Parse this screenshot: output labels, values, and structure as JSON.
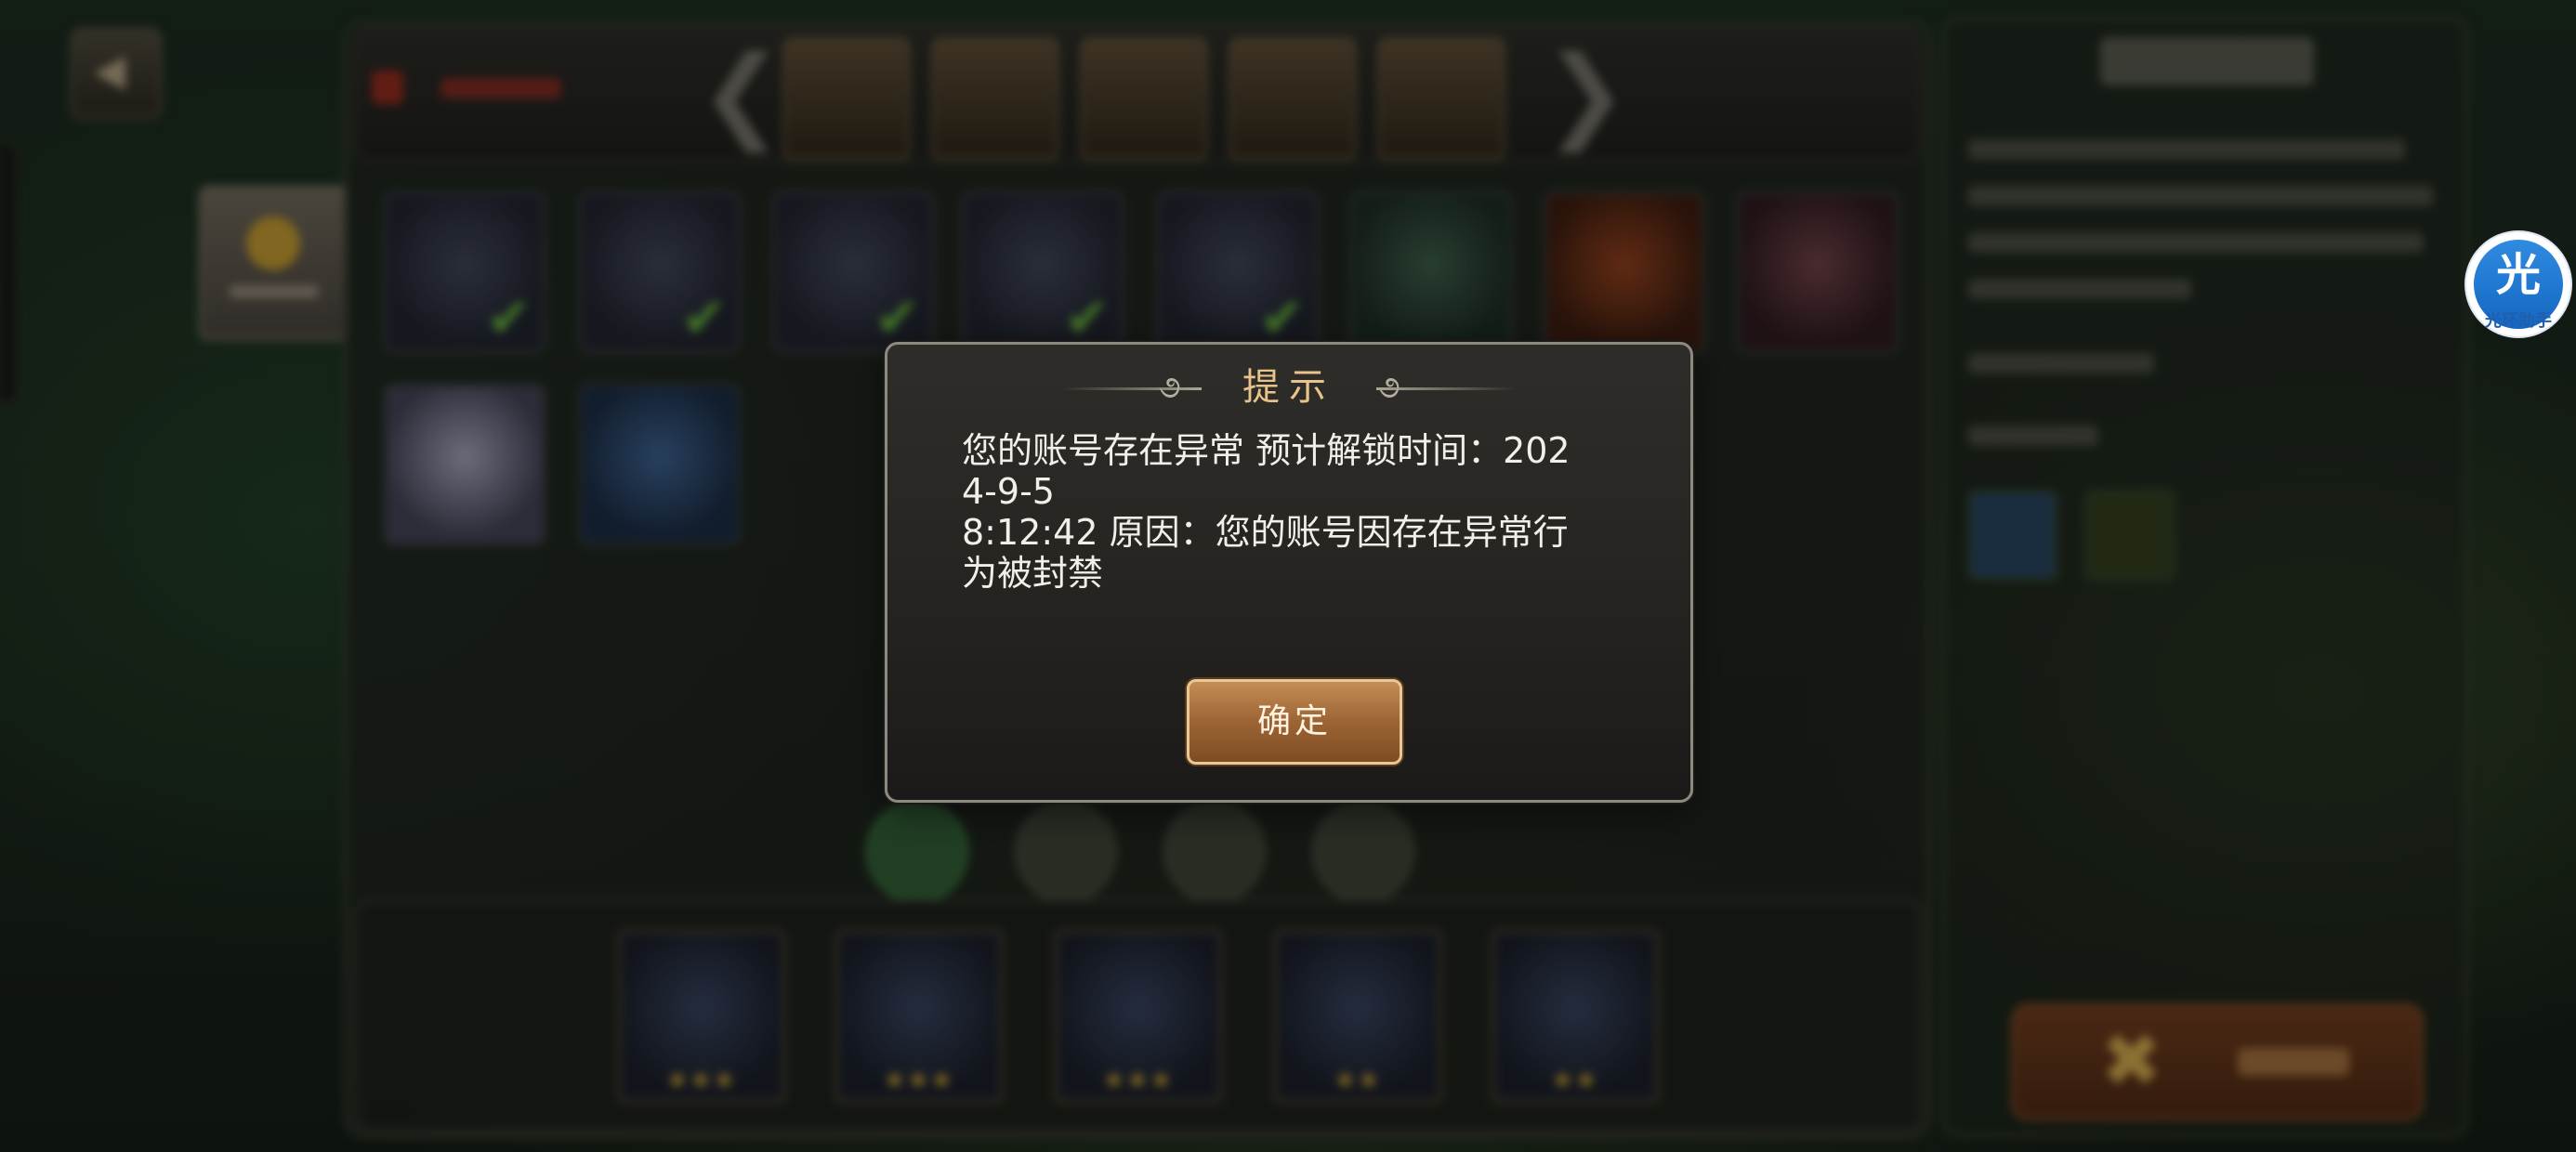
{
  "dialog": {
    "title": "提示",
    "message": "您的账号存在异常 预计解锁时间：202\n4-9-5\n8:12:42 原因：您的账号因存在异常行\n为被封禁",
    "confirm_label": "确定"
  },
  "helper_badge": {
    "glyph": "光",
    "caption": "光环助手"
  },
  "icons": {
    "back": "back-arrow-icon",
    "prev": "chevron-left-icon",
    "next": "chevron-right-icon",
    "check": "checkmark-icon",
    "close": "cross-icon"
  },
  "colors": {
    "dialog_title": "#e8c48a",
    "button_fill": "#9c6434",
    "check_green": "#5fa63a",
    "helper_blue": "#1467c2"
  }
}
